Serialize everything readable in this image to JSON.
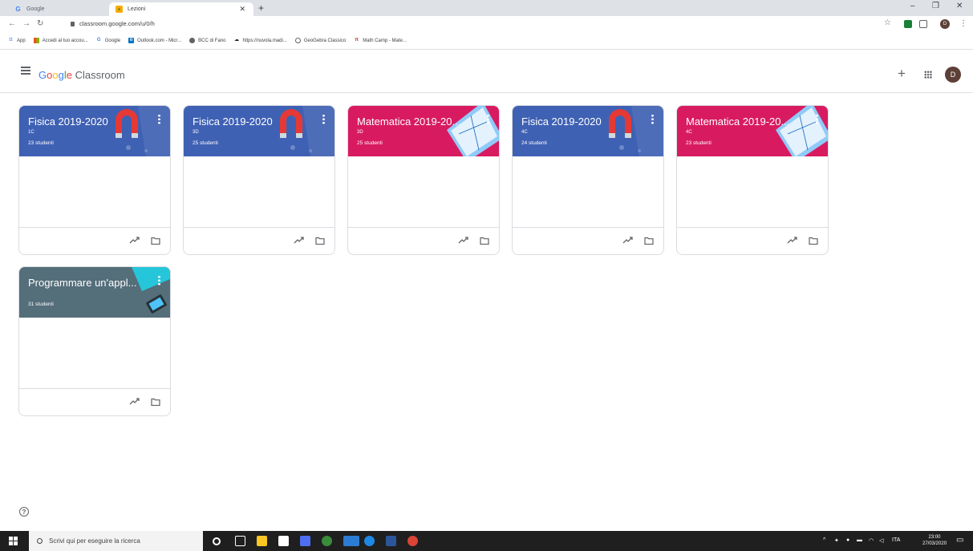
{
  "browser": {
    "tabs": [
      {
        "label": "Google",
        "icon": "google-favicon",
        "active": false
      },
      {
        "label": "Lezioni",
        "icon": "classroom-favicon",
        "active": true
      }
    ],
    "url": "classroom.google.com/u/0/h",
    "bookmarks": [
      {
        "label": "App",
        "icon": "apps-grid-icon"
      },
      {
        "label": "Accedi al tuo accou...",
        "icon": "microsoft-icon"
      },
      {
        "label": "Google",
        "icon": "google-icon"
      },
      {
        "label": "Outlook.com - Micr...",
        "icon": "outlook-icon"
      },
      {
        "label": "BCC di Fano",
        "icon": "globe-icon"
      },
      {
        "label": "https://nuvola.madi...",
        "icon": "cloud-icon"
      },
      {
        "label": "GeoGebra Classico",
        "icon": "geogebra-icon"
      },
      {
        "label": "Math Camp - Mate...",
        "icon": "mathcamp-icon"
      }
    ],
    "profile_initial": "D"
  },
  "header": {
    "brand_google": [
      "G",
      "o",
      "o",
      "g",
      "l",
      "e"
    ],
    "brand_product": "Classroom",
    "avatar_initial": "D"
  },
  "classes": [
    {
      "title": "Fisica 2019-2020",
      "section": "1C",
      "students": "23 studenti",
      "theme": "blue",
      "art": "magnet"
    },
    {
      "title": "Fisica 2019-2020",
      "section": "3D",
      "students": "25 studenti",
      "theme": "blue",
      "art": "magnet"
    },
    {
      "title": "Matematica 2019-20...",
      "section": "3D",
      "students": "25 studenti",
      "theme": "pink",
      "art": "geometry"
    },
    {
      "title": "Fisica 2019-2020",
      "section": "4C",
      "students": "24 studenti",
      "theme": "blue",
      "art": "magnet"
    },
    {
      "title": "Matematica 2019-20...",
      "section": "4C",
      "students": "23 studenti",
      "theme": "pink",
      "art": "geometry"
    },
    {
      "title": "Programmare un'appl...",
      "section": "",
      "students": "31 studenti",
      "theme": "slate",
      "art": "tablet"
    }
  ],
  "taskbar": {
    "search_placeholder": "Scrivi qui per eseguire la ricerca",
    "language": "ITA",
    "time": "23:00",
    "date": "27/03/2020"
  },
  "colors": {
    "blue": "#3f61b4",
    "pink": "#d81b60",
    "slate": "#546e7a"
  }
}
